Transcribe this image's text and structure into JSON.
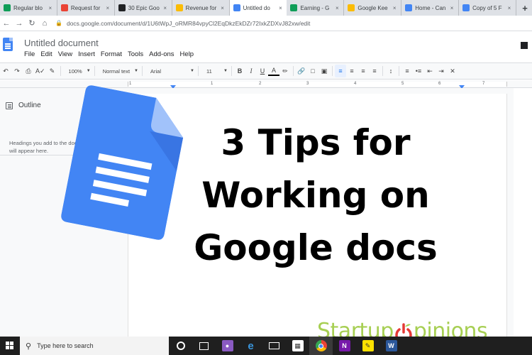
{
  "browser": {
    "tabs": [
      {
        "label": "Regular blo",
        "favicon": "sheets-icon",
        "color": "#0f9d58",
        "active": false
      },
      {
        "label": "Request for",
        "favicon": "gmail-icon",
        "color": "#ea4335",
        "active": false
      },
      {
        "label": "30 Epic Goo",
        "favicon": "image-icon",
        "color": "#202124",
        "active": false
      },
      {
        "label": "Revenue for",
        "favicon": "drive-icon",
        "color": "#fbbc04",
        "active": false
      },
      {
        "label": "Untitled do",
        "favicon": "docs-icon",
        "color": "#4285f4",
        "active": true
      },
      {
        "label": "Earning - G",
        "favicon": "sheets-icon",
        "color": "#0f9d58",
        "active": false
      },
      {
        "label": "Google Kee",
        "favicon": "keep-icon",
        "color": "#fbbc04",
        "active": false
      },
      {
        "label": "Home - Can",
        "favicon": "canva-icon",
        "color": "#4285f4",
        "active": false
      },
      {
        "label": "Copy of 5 F",
        "favicon": "canva-icon",
        "color": "#4285f4",
        "active": false
      }
    ],
    "new_tab_label": "+",
    "url": "docs.google.com/document/d/1U6tWpJ_oRMR84vpyCl2EqDkzEkDZr72IxkZDXvJ82xw/edit"
  },
  "docs": {
    "title": "Untitled document",
    "menu": [
      "File",
      "Edit",
      "View",
      "Insert",
      "Format",
      "Tools",
      "Add-ons",
      "Help"
    ]
  },
  "toolbar": {
    "zoom": "100%",
    "style": "Normal text",
    "font": "Arial",
    "size": "11",
    "bold": "B",
    "italic": "I",
    "underline": "U",
    "text_color": "A"
  },
  "ruler": {
    "numbers": [
      "1",
      "1",
      "2",
      "3",
      "4",
      "5",
      "6",
      "7"
    ]
  },
  "outline": {
    "title": "Outline",
    "hint_line1": "Headings you add to the docum",
    "hint_line2": "will appear here."
  },
  "headline": {
    "line1": "3 Tips for",
    "line2": "Working on",
    "line3": "Google docs"
  },
  "watermark": {
    "part1": "Startup",
    "part2": "pinions",
    "accent": "#e53935",
    "green": "#a7cf53"
  },
  "taskbar": {
    "search_placeholder": "Type here to search"
  }
}
